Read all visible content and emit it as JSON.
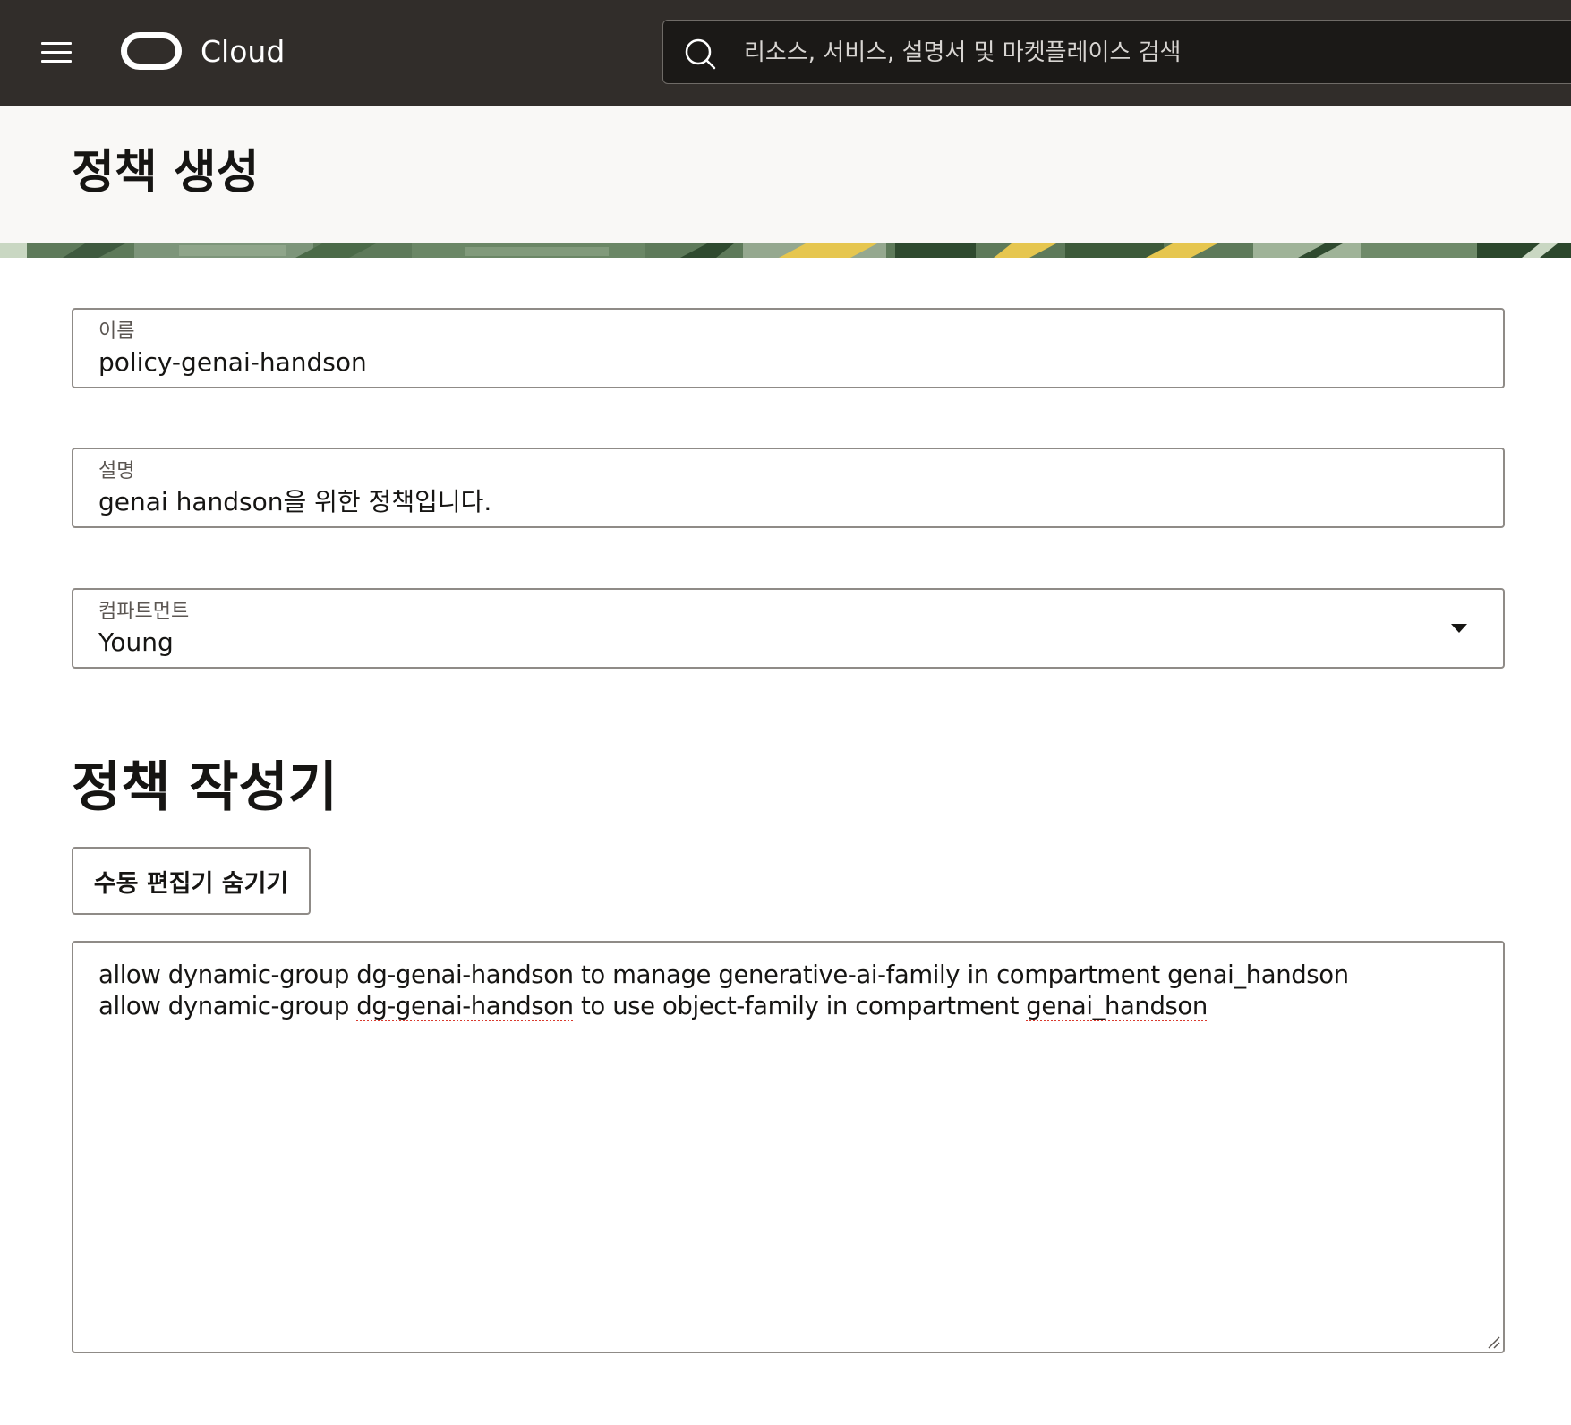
{
  "header": {
    "brand": "Cloud",
    "search_placeholder": "리소스, 서비스, 설명서 및 마켓플레이스 검색",
    "icons": [
      "menu-icon",
      "oracle-logo",
      "search-icon"
    ]
  },
  "page": {
    "title": "정책 생성"
  },
  "form": {
    "name": {
      "label": "이름",
      "value": "policy-genai-handson"
    },
    "description": {
      "label": "설명",
      "value": "genai handson을 위한 정책입니다."
    },
    "compartment": {
      "label": "컴파트먼트",
      "value": "Young"
    }
  },
  "builder": {
    "title": "정책 작성기",
    "toggle_button": "수동 편집기 숨기기",
    "statements": [
      {
        "text": "allow dynamic-group dg-genai-handson to manage generative-ai-family in compartment genai_handson"
      },
      {
        "prefix": "allow dynamic-group ",
        "flag1": "dg-genai-handson",
        "middle": " to use object-family in compartment ",
        "flag2": "genai_handson"
      }
    ]
  }
}
